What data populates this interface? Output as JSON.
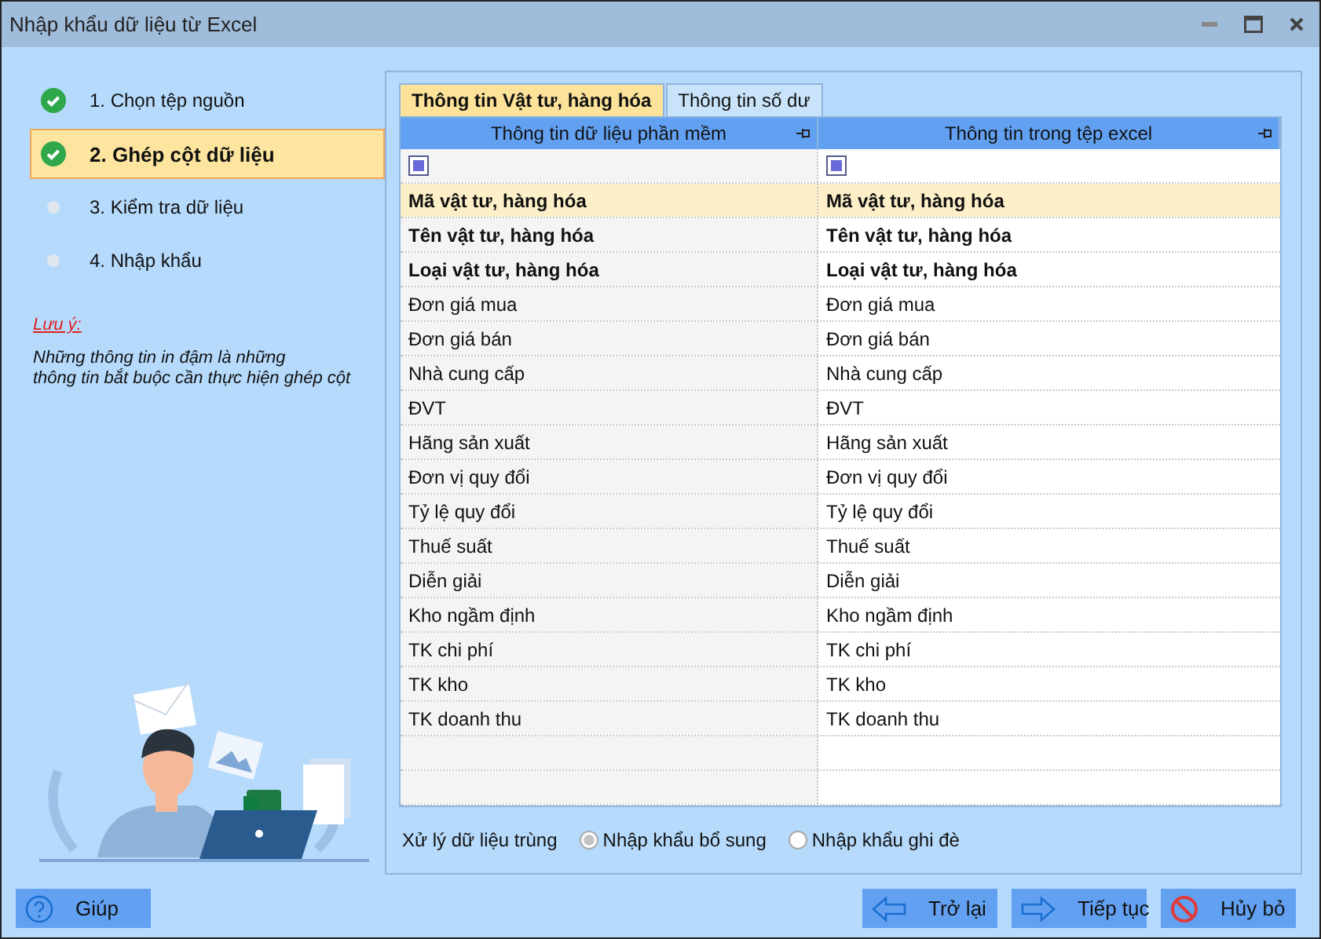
{
  "window": {
    "title": "Nhập khẩu dữ liệu từ Excel"
  },
  "steps": [
    {
      "label": "1. Chọn tệp nguồn",
      "done": true,
      "selected": false
    },
    {
      "label": "2. Ghép cột dữ liệu",
      "done": true,
      "selected": true
    },
    {
      "label": "3. Kiểm tra dữ liệu",
      "done": false,
      "selected": false
    },
    {
      "label": "4. Nhập khẩu",
      "done": false,
      "selected": false
    }
  ],
  "note": {
    "title": "Lưu ý:",
    "text": "Những thông tin in đậm là những\nthông tin bắt buộc cần thực hiện ghép cột"
  },
  "tabs": [
    {
      "label": "Thông tin Vật tư, hàng hóa",
      "selected": true
    },
    {
      "label": "Thông tin số dư",
      "selected": false
    }
  ],
  "table": {
    "columns": [
      "Thông tin dữ liệu phần mềm",
      "Thông tin trong tệp excel"
    ],
    "filter_checkboxes": [
      {
        "checked": true
      },
      {
        "checked": true
      }
    ],
    "rows": [
      {
        "software": "Mã vật tư, hàng hóa",
        "excel": "Mã vật tư, hàng hóa",
        "required": true,
        "selected": true
      },
      {
        "software": "Tên vật tư, hàng hóa",
        "excel": "Tên vật tư, hàng hóa",
        "required": true,
        "selected": false
      },
      {
        "software": "Loại vật tư, hàng hóa",
        "excel": "Loại vật tư, hàng hóa",
        "required": true,
        "selected": false
      },
      {
        "software": "Đơn giá mua",
        "excel": "Đơn giá mua",
        "required": false,
        "selected": false
      },
      {
        "software": "Đơn giá bán",
        "excel": "Đơn giá bán",
        "required": false,
        "selected": false
      },
      {
        "software": "Nhà cung cấp",
        "excel": "Nhà cung cấp",
        "required": false,
        "selected": false
      },
      {
        "software": "ĐVT",
        "excel": "ĐVT",
        "required": false,
        "selected": false
      },
      {
        "software": "Hãng sản xuất",
        "excel": "Hãng sản xuất",
        "required": false,
        "selected": false
      },
      {
        "software": "Đơn vị quy đổi",
        "excel": "Đơn vị quy đổi",
        "required": false,
        "selected": false
      },
      {
        "software": "Tỷ lệ quy đổi",
        "excel": "Tỷ lệ quy đổi",
        "required": false,
        "selected": false
      },
      {
        "software": "Thuế suất",
        "excel": "Thuế suất",
        "required": false,
        "selected": false
      },
      {
        "software": "Diễn giải",
        "excel": "Diễn giải",
        "required": false,
        "selected": false
      },
      {
        "software": "Kho ngầm định",
        "excel": "Kho ngầm định",
        "required": false,
        "selected": false
      },
      {
        "software": "TK chi phí",
        "excel": "TK chi phí",
        "required": false,
        "selected": false
      },
      {
        "software": "TK kho",
        "excel": "TK kho",
        "required": false,
        "selected": false
      },
      {
        "software": "TK doanh thu",
        "excel": "TK doanh thu",
        "required": false,
        "selected": false
      }
    ]
  },
  "duplicate_handling": {
    "label": "Xử lý dữ liệu trùng",
    "options": [
      {
        "label": "Nhập khẩu bổ sung",
        "selected": true
      },
      {
        "label": "Nhập khẩu ghi đè",
        "selected": false
      }
    ]
  },
  "buttons": [
    {
      "kind": "help",
      "label": "Giúp"
    },
    {
      "kind": "back",
      "label": "Trở lại"
    },
    {
      "kind": "next",
      "label": "Tiếp tục"
    },
    {
      "kind": "cancel",
      "label": "Hủy bỏ"
    }
  ]
}
